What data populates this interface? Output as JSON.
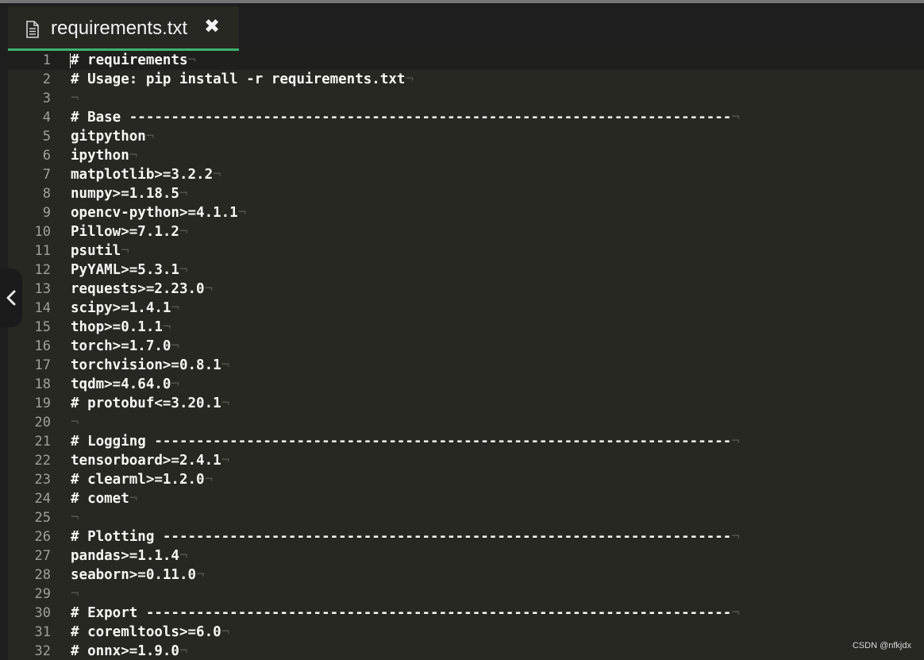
{
  "tab": {
    "title": "requirements.txt",
    "close_glyph": "✖",
    "icon": "file-text-icon"
  },
  "side_toggle": {
    "icon": "chevron-left-icon"
  },
  "eol_marker": "¬",
  "lines": [
    {
      "n": "1",
      "text": "# requirements"
    },
    {
      "n": "2",
      "text": "# Usage: pip install -r requirements.txt"
    },
    {
      "n": "3",
      "text": ""
    },
    {
      "n": "4",
      "text": "# Base ------------------------------------------------------------------------"
    },
    {
      "n": "5",
      "text": "gitpython"
    },
    {
      "n": "6",
      "text": "ipython"
    },
    {
      "n": "7",
      "text": "matplotlib>=3.2.2"
    },
    {
      "n": "8",
      "text": "numpy>=1.18.5"
    },
    {
      "n": "9",
      "text": "opencv-python>=4.1.1"
    },
    {
      "n": "10",
      "text": "Pillow>=7.1.2"
    },
    {
      "n": "11",
      "text": "psutil"
    },
    {
      "n": "12",
      "text": "PyYAML>=5.3.1"
    },
    {
      "n": "13",
      "text": "requests>=2.23.0"
    },
    {
      "n": "14",
      "text": "scipy>=1.4.1"
    },
    {
      "n": "15",
      "text": "thop>=0.1.1"
    },
    {
      "n": "16",
      "text": "torch>=1.7.0"
    },
    {
      "n": "17",
      "text": "torchvision>=0.8.1"
    },
    {
      "n": "18",
      "text": "tqdm>=4.64.0"
    },
    {
      "n": "19",
      "text": "# protobuf<=3.20.1"
    },
    {
      "n": "20",
      "text": ""
    },
    {
      "n": "21",
      "text": "# Logging ---------------------------------------------------------------------"
    },
    {
      "n": "22",
      "text": "tensorboard>=2.4.1"
    },
    {
      "n": "23",
      "text": "# clearml>=1.2.0"
    },
    {
      "n": "24",
      "text": "# comet"
    },
    {
      "n": "25",
      "text": ""
    },
    {
      "n": "26",
      "text": "# Plotting --------------------------------------------------------------------"
    },
    {
      "n": "27",
      "text": "pandas>=1.1.4"
    },
    {
      "n": "28",
      "text": "seaborn>=0.11.0"
    },
    {
      "n": "29",
      "text": ""
    },
    {
      "n": "30",
      "text": "# Export ----------------------------------------------------------------------"
    },
    {
      "n": "31",
      "text": "# coremltools>=6.0"
    },
    {
      "n": "32",
      "text": "# onnx>=1.9.0"
    }
  ],
  "watermark": "CSDN @nfkjdx"
}
